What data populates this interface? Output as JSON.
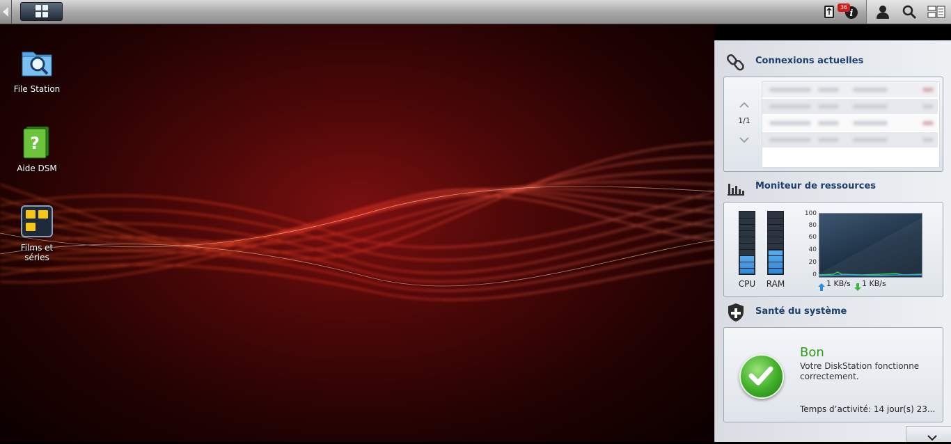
{
  "taskbar": {
    "main_menu_icon": "grid-icon",
    "notification_badge": "36",
    "icons": [
      "usb-icon",
      "info-icon",
      "user-icon",
      "search-icon",
      "widgets-icon"
    ]
  },
  "desktop": {
    "icons": [
      {
        "label": "File Station",
        "icon": "file-station-icon"
      },
      {
        "label": "Aide DSM",
        "icon": "help-book-icon"
      },
      {
        "label": "Films et séries",
        "icon": "video-station-icon"
      }
    ]
  },
  "widgets": {
    "connections": {
      "title": "Connexions actuelles",
      "page": "1/1"
    },
    "resources": {
      "title": "Moniteur de ressources",
      "cpu_label": "CPU",
      "ram_label": "RAM",
      "cpu_level": 0.3,
      "ram_level": 0.38,
      "y_ticks": [
        "100",
        "80",
        "60",
        "40",
        "20",
        "0"
      ],
      "upload": "1 KB/s",
      "download": "1 KB/s"
    },
    "health": {
      "title": "Santé du système",
      "status": "Bon",
      "message": "Votre DiskStation fonctionne correctement.",
      "uptime": "Temps d’activité: 14 jour(s) 23..."
    }
  },
  "colors": {
    "accent": "#1d3f6e",
    "ok_green": "#2e9c1a",
    "meter_blue": "#3a98e4"
  }
}
